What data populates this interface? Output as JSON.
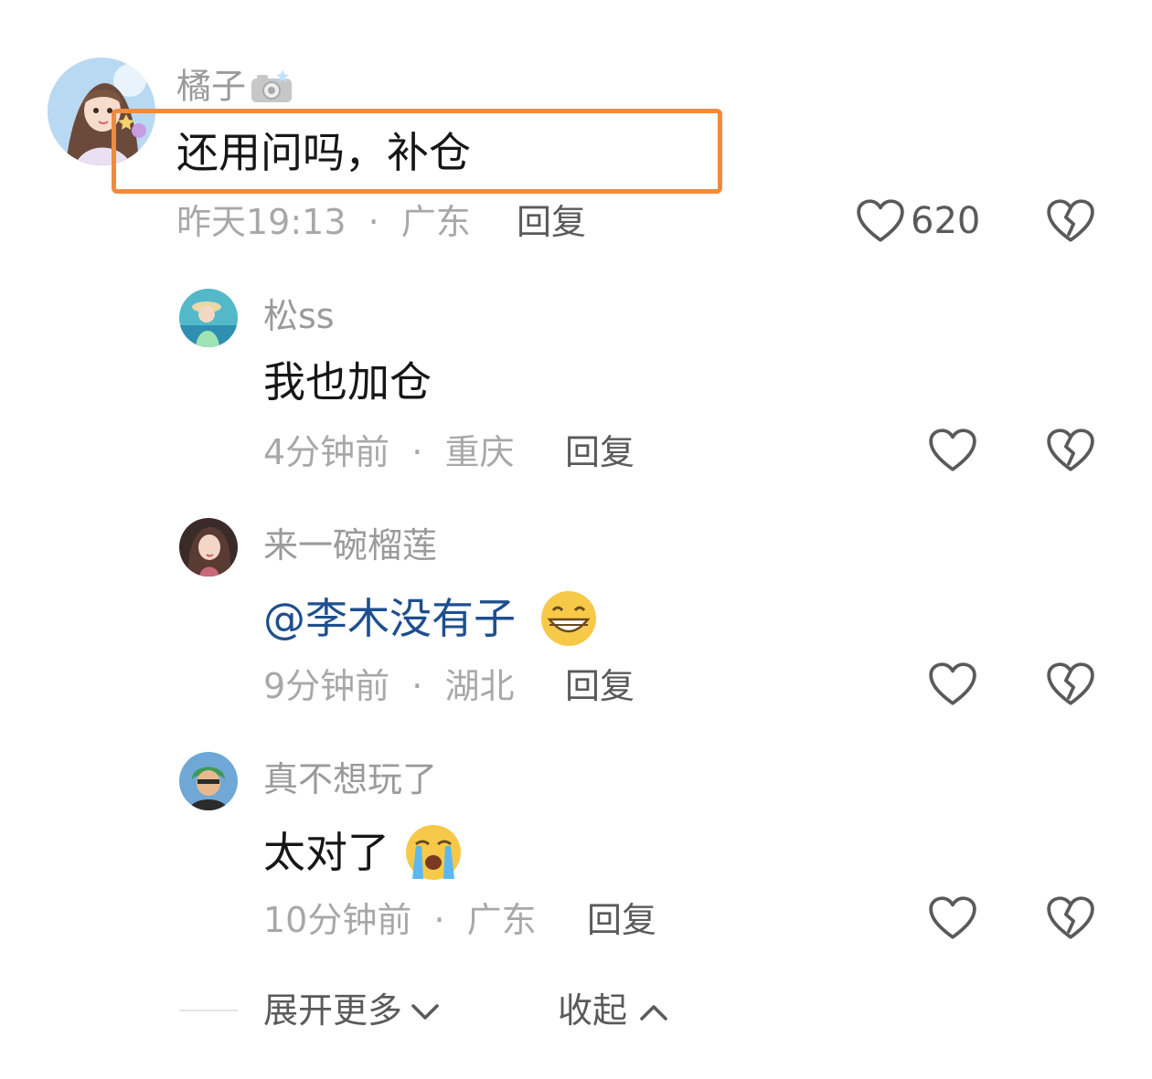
{
  "main_comment": {
    "username": "橘子",
    "badge_icon": "camera-icon",
    "text": "还用问吗，补仓",
    "time": "昨天19:13",
    "location": "广东",
    "reply_label": "回复",
    "like_count": "620"
  },
  "replies": [
    {
      "username": "松ss",
      "text": "我也加仓",
      "time": "4分钟前",
      "location": "重庆",
      "reply_label": "回复"
    },
    {
      "username": "来一碗榴莲",
      "mention": "@李木没有子",
      "emoji": "grinning-face-emoji",
      "time": "9分钟前",
      "location": "湖北",
      "reply_label": "回复"
    },
    {
      "username": "真不想玩了",
      "text": "太对了",
      "emoji": "loudly-crying-face-emoji",
      "time": "10分钟前",
      "location": "广东",
      "reply_label": "回复"
    }
  ],
  "separator": "·",
  "footer": {
    "expand_label": "展开更多",
    "collapse_label": "收起"
  },
  "colors": {
    "highlight_border": "#ef8b3c",
    "mention": "#1e4f8e"
  }
}
